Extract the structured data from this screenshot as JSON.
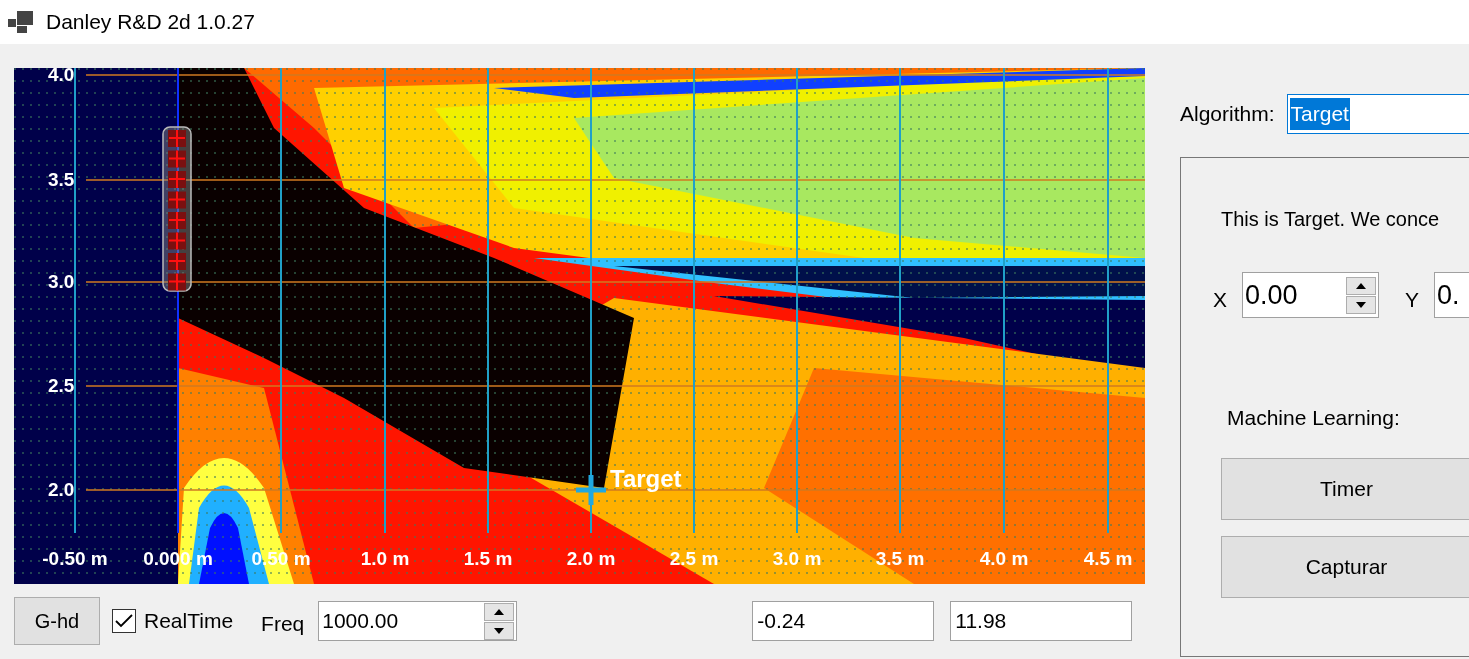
{
  "window": {
    "title": "Danley R&D 2d 1.0.27"
  },
  "plot": {
    "y_labels": [
      "4.0",
      "3.5",
      "3.0",
      "2.5",
      "2.0"
    ],
    "x_labels": [
      "-0.50 m",
      "0.000 m",
      "0.50 m",
      "1.0 m",
      "1.5 m",
      "2.0 m",
      "2.5 m",
      "3.0 m",
      "3.5 m",
      "4.0 m",
      "4.5 m"
    ],
    "target_label": "Target"
  },
  "bottom_bar": {
    "button": "G-hd",
    "realtime": {
      "label": "RealTime",
      "checked": true
    },
    "freq": {
      "label": "Freq",
      "value": "1000.00"
    },
    "readouts": [
      "-0.24",
      "11.98"
    ]
  },
  "algorithm": {
    "label": "Algorithm:",
    "value": "Target",
    "text_selected": true
  },
  "panel": {
    "description": "This is Target. We conce",
    "x": {
      "label": "X",
      "value": "0.00"
    },
    "y": {
      "label": "Y",
      "value": "0."
    },
    "ml_label": "Machine Learning:",
    "buttons": [
      "Timer",
      "Capturar"
    ]
  }
}
